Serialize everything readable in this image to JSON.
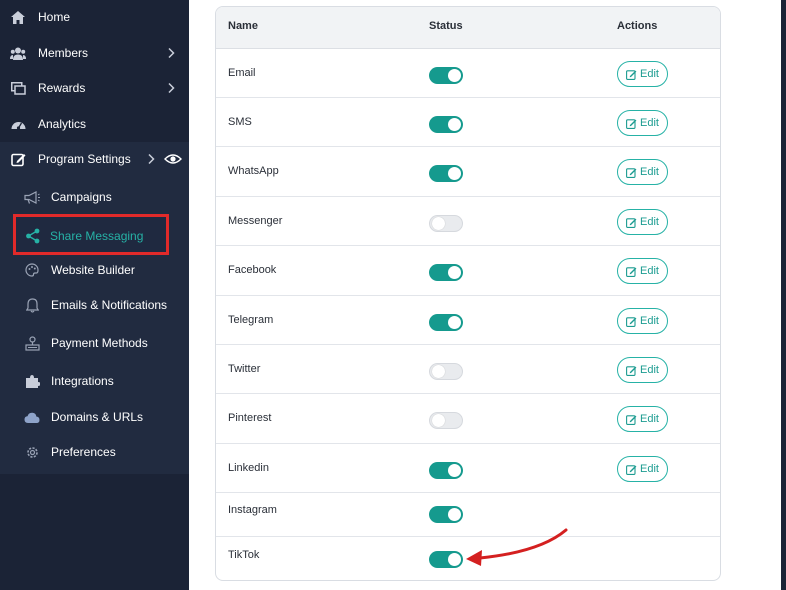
{
  "sidebar": {
    "items": [
      {
        "label": "Home",
        "icon": "home-icon"
      },
      {
        "label": "Members",
        "icon": "users-icon"
      },
      {
        "label": "Rewards",
        "icon": "rewards-icon"
      },
      {
        "label": "Analytics",
        "icon": "dashboard-icon"
      },
      {
        "label": "Program Settings",
        "icon": "edit-icon"
      }
    ],
    "sub_items": [
      {
        "label": "Campaigns",
        "icon": "megaphone-icon"
      },
      {
        "label": "Share Messaging",
        "icon": "share-icon"
      },
      {
        "label": "Website Builder",
        "icon": "palette-icon"
      },
      {
        "label": "Emails & Notifications",
        "icon": "bell-icon"
      },
      {
        "label": "Payment Methods",
        "icon": "payment-icon"
      },
      {
        "label": "Integrations",
        "icon": "puzzle-icon"
      },
      {
        "label": "Domains & URLs",
        "icon": "cloud-icon"
      },
      {
        "label": "Preferences",
        "icon": "gear-icon"
      }
    ],
    "active_item": "Share Messaging"
  },
  "table": {
    "headers": {
      "name": "Name",
      "status": "Status",
      "actions": "Actions"
    },
    "edit_label": "Edit",
    "rows": [
      {
        "name": "Email",
        "enabled": true,
        "editable": true
      },
      {
        "name": "SMS",
        "enabled": true,
        "editable": true
      },
      {
        "name": "WhatsApp",
        "enabled": true,
        "editable": true
      },
      {
        "name": "Messenger",
        "enabled": false,
        "editable": true
      },
      {
        "name": "Facebook",
        "enabled": true,
        "editable": true
      },
      {
        "name": "Telegram",
        "enabled": true,
        "editable": true
      },
      {
        "name": "Twitter",
        "enabled": false,
        "editable": true
      },
      {
        "name": "Pinterest",
        "enabled": false,
        "editable": true
      },
      {
        "name": "Linkedin",
        "enabled": true,
        "editable": true
      },
      {
        "name": "Instagram",
        "enabled": true,
        "editable": false
      },
      {
        "name": "TikTok",
        "enabled": true,
        "editable": false
      }
    ]
  },
  "colors": {
    "sidebar_bg": "#1b2336",
    "accent": "#159a8e",
    "highlight_border": "#e12a2a",
    "arrow": "#d42020"
  }
}
